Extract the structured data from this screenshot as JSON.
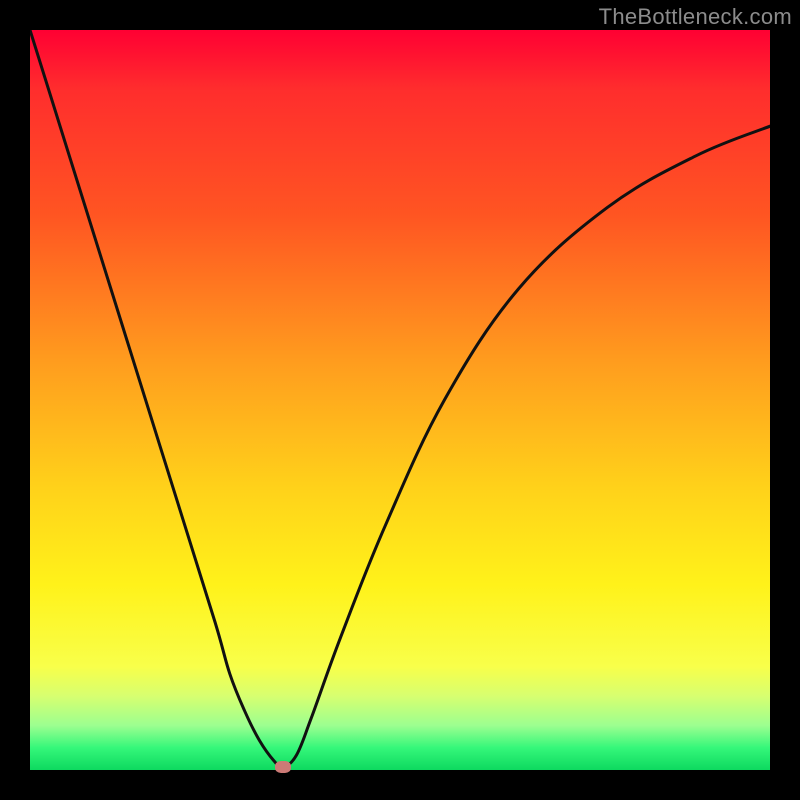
{
  "attribution": "TheBottleneck.com",
  "colors": {
    "page_bg": "#000000",
    "text": "#8c8c8c",
    "curve_stroke": "#111111",
    "dot_fill": "#cc7a76"
  },
  "chart_data": {
    "type": "line",
    "title": "",
    "xlabel": "",
    "ylabel": "",
    "xlim": [
      0,
      100
    ],
    "ylim": [
      0,
      100
    ],
    "grid": false,
    "legend": false,
    "series": [
      {
        "name": "bottleneck-curve",
        "x": [
          0,
          5,
          10,
          15,
          20,
          25,
          27,
          29,
          31,
          33,
          34.2,
          36,
          38,
          42,
          48,
          56,
          66,
          78,
          90,
          100
        ],
        "values": [
          100,
          84,
          68,
          52,
          36,
          20,
          13,
          8,
          4,
          1.2,
          0.4,
          2,
          7,
          18,
          33,
          50,
          65,
          76,
          83,
          87
        ]
      }
    ],
    "marker": {
      "name": "minimum",
      "x": 34.2,
      "y": 0.4
    }
  }
}
